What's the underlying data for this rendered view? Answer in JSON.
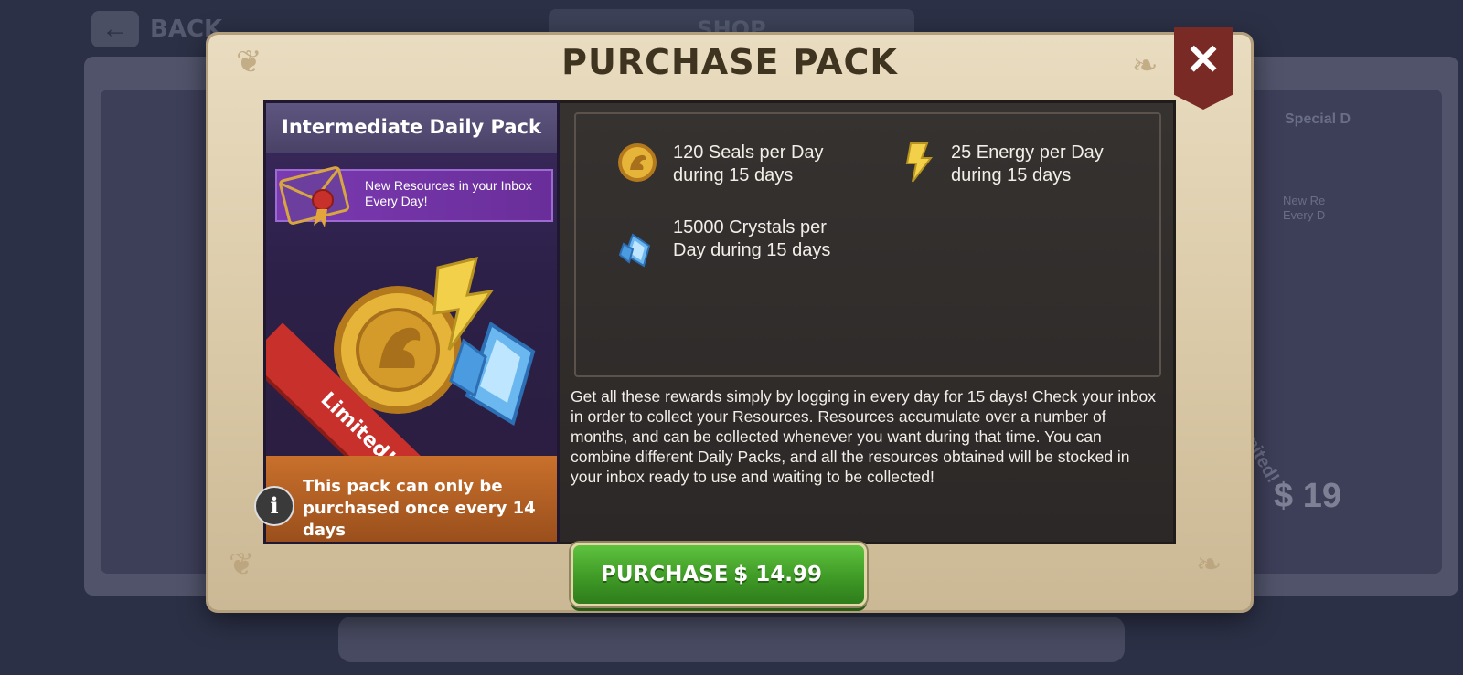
{
  "background": {
    "back_label": "BACK",
    "shop_tab": "SHOP",
    "side_card_title": "Special D",
    "side_card_inbox": "New Re Every D",
    "side_card_price": "$ 19",
    "side_card_ribbon": "Limited!"
  },
  "modal": {
    "title": "PURCHASE PACK",
    "close_icon": "close-icon"
  },
  "pack": {
    "name": "Intermediate Daily Pack",
    "inbox_banner": "New Resources in your Inbox Every Day!",
    "ribbon": "Limited!",
    "footer_note": "This pack can only be purchased once every 14 days",
    "info_icon_glyph": "i"
  },
  "rewards": [
    {
      "icon": "seal-coin-icon",
      "text": "120 Seals per Day during 15 days"
    },
    {
      "icon": "energy-bolt-icon",
      "text": "25 Energy per Day during 15 days"
    },
    {
      "icon": "crystal-icon",
      "text": "15000 Crystals per Day during 15 days"
    }
  ],
  "description": "Get all these rewards simply by logging in every day for 15 days! Check your inbox in order to collect your Resources. Resources accumulate over a number of months, and can be collected whenever you want during that time. You can combine different Daily Packs, and all the resources obtained will be stocked in your inbox ready to use and waiting to be collected!",
  "purchase": {
    "label": "PURCHASE",
    "price": "$ 14.99"
  },
  "colors": {
    "parchment": "#e9dcc0",
    "close_ribbon": "#7a2a24",
    "purchase_green": "#3f9a26",
    "limited_red": "#c8302b",
    "footer_orange": "#c9702c"
  }
}
